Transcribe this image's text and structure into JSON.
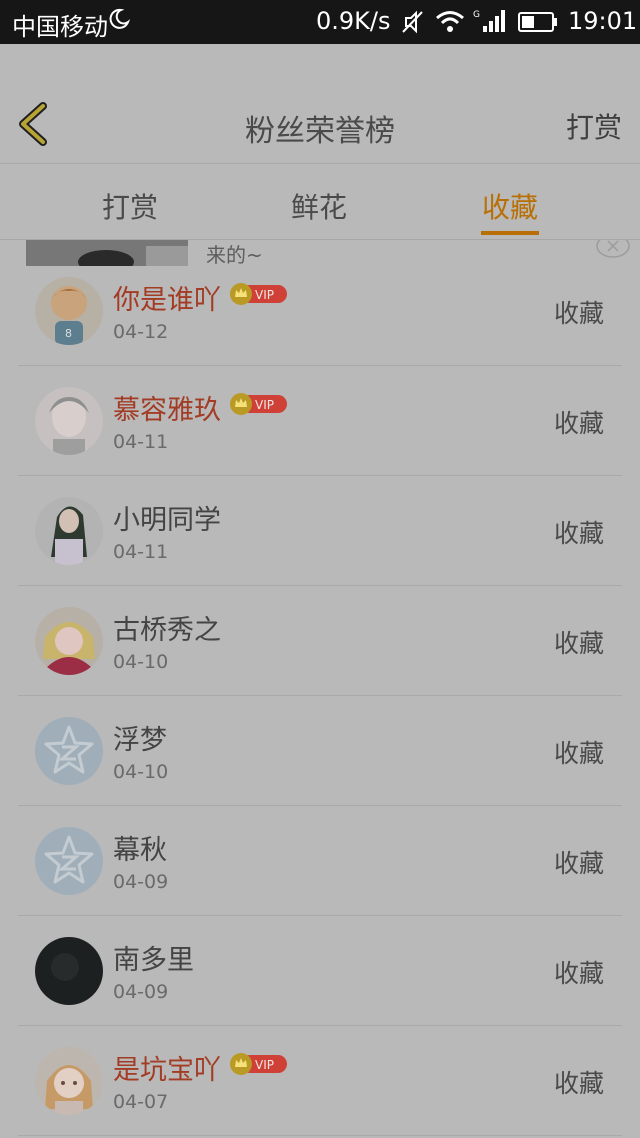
{
  "status_bar": {
    "carrier": "中国移动",
    "net_speed": "0.9K/s",
    "time": "19:01"
  },
  "header": {
    "title": "粉丝荣誉榜",
    "right_link": "打赏"
  },
  "tabs": [
    {
      "label": "打赏",
      "active": false
    },
    {
      "label": "鲜花",
      "active": false
    },
    {
      "label": "收藏",
      "active": true
    }
  ],
  "ad": {
    "text": "来的~"
  },
  "colors": {
    "accent": "#b87006",
    "vip_name": "#a33c25",
    "vip_badge": "#cf4137"
  },
  "vip_label": "VIP",
  "list": [
    {
      "name": "你是谁吖",
      "vip": true,
      "date": "04-12",
      "action": "收藏",
      "avatar_icon": "cartoon-boy-avatar"
    },
    {
      "name": "慕容雅玖",
      "vip": true,
      "date": "04-11",
      "action": "收藏",
      "avatar_icon": "photo-avatar"
    },
    {
      "name": "小明同学",
      "vip": false,
      "date": "04-11",
      "action": "收藏",
      "avatar_icon": "girl-photo-avatar"
    },
    {
      "name": "古桥秀之",
      "vip": false,
      "date": "04-10",
      "action": "收藏",
      "avatar_icon": "anime-girl-avatar"
    },
    {
      "name": "浮梦",
      "vip": false,
      "date": "04-10",
      "action": "收藏",
      "avatar_icon": "default-star-avatar"
    },
    {
      "name": "幕秋",
      "vip": false,
      "date": "04-09",
      "action": "收藏",
      "avatar_icon": "default-star-avatar"
    },
    {
      "name": "南多里",
      "vip": false,
      "date": "04-09",
      "action": "收藏",
      "avatar_icon": "dark-avatar"
    },
    {
      "name": "是坑宝吖",
      "vip": true,
      "date": "04-07",
      "action": "收藏",
      "avatar_icon": "cartoon-girl-avatar"
    }
  ]
}
